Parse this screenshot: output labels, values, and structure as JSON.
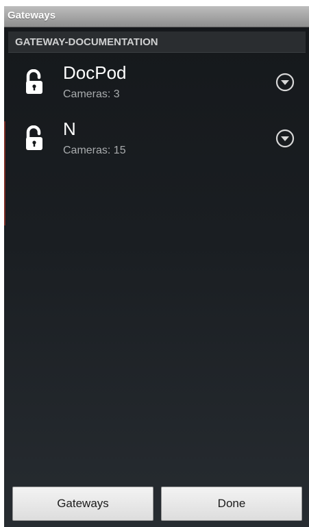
{
  "window": {
    "title": "Gateways"
  },
  "section": {
    "title": "GATEWAY-DOCUMENTATION"
  },
  "gateways": [
    {
      "name": "DocPod",
      "cameras": "Cameras: 3",
      "icon": "unlocked-padlock-icon"
    },
    {
      "name": "N",
      "cameras": "Cameras: 15",
      "icon": "unlocked-padlock-icon"
    }
  ],
  "footer": {
    "gateways_label": "Gateways",
    "done_label": "Done"
  },
  "colors": {
    "title_bar": "#a6a6a6",
    "background_top": "#15181b",
    "background_bottom": "#272c31",
    "section_header": "#2a2d30",
    "button": "#e8e8e8",
    "name_text": "#ffffff",
    "secondary_text": "#a9acae"
  }
}
